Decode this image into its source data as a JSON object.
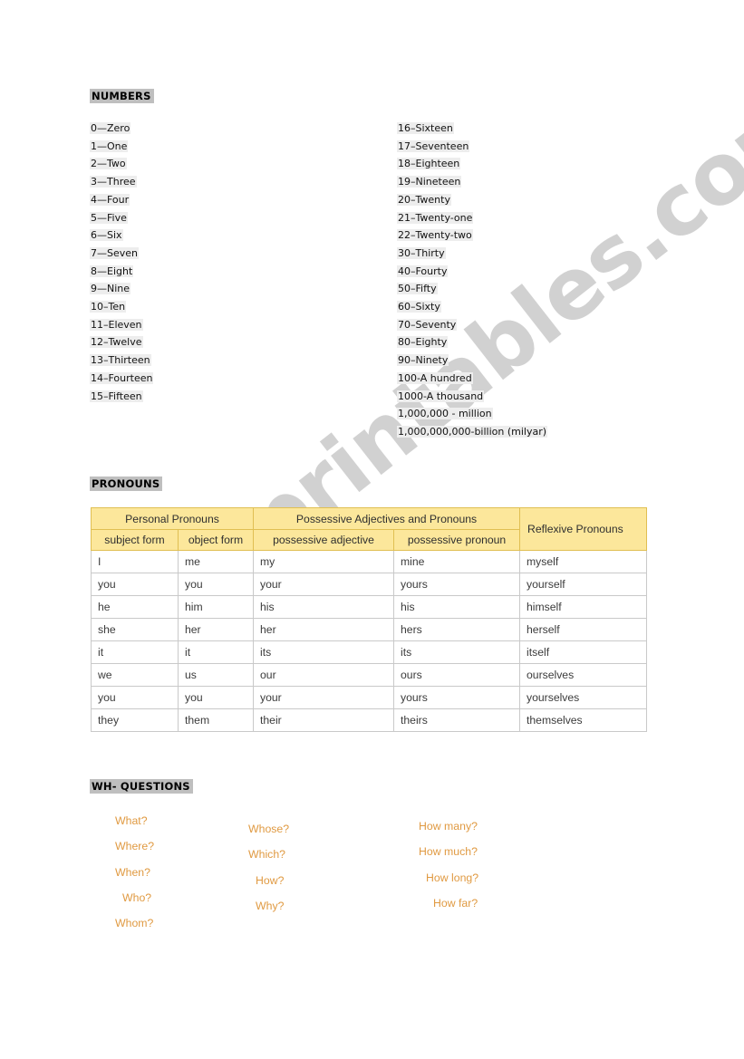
{
  "worksheet": {
    "watermark": "ESLprintables.com"
  },
  "numbers": {
    "heading": "NUMBERS",
    "left_column": [
      "0—Zero",
      "1—One",
      "2—Two",
      "3—Three",
      "4—Four",
      "5—Five",
      "6—Six",
      "7—Seven",
      "8—Eight",
      "9—Nine",
      "10–Ten",
      "11–Eleven",
      "12–Twelve",
      "13–Thirteen",
      "14–Fourteen",
      "15–Fifteen"
    ],
    "right_column": [
      "16–Sixteen",
      "17–Seventeen",
      "18–Eighteen",
      "19–Nineteen",
      "20–Twenty",
      "21–Twenty-one",
      "22–Twenty-two",
      "30–Thirty",
      "40–Fourty",
      "50–Fifty",
      "60–Sixty",
      "70–Seventy",
      "80–Eighty",
      "90–Ninety",
      "100-A hundred",
      "1000-A thousand",
      "1,000,000 - million",
      "1,000,000,000-billion (milyar)"
    ]
  },
  "pronouns": {
    "heading": "PRONOUNS",
    "group_headers": {
      "personal": "Personal Pronouns",
      "possessive": "Possessive Adjectives and Pronouns",
      "reflexive": "Reflexive Pronouns"
    },
    "sub_headers": {
      "subject": "subject form",
      "object": "object form",
      "poss_adjective": "possessive adjective",
      "poss_pronoun": "possessive pronoun"
    },
    "rows": [
      {
        "subject": "I",
        "object": "me",
        "poss_adjective": "my",
        "poss_pronoun": "mine",
        "reflexive": "myself"
      },
      {
        "subject": "you",
        "object": "you",
        "poss_adjective": "your",
        "poss_pronoun": "yours",
        "reflexive": "yourself"
      },
      {
        "subject": "he",
        "object": "him",
        "poss_adjective": "his",
        "poss_pronoun": "his",
        "reflexive": "himself"
      },
      {
        "subject": "she",
        "object": "her",
        "poss_adjective": "her",
        "poss_pronoun": "hers",
        "reflexive": "herself"
      },
      {
        "subject": "it",
        "object": "it",
        "poss_adjective": "its",
        "poss_pronoun": "its",
        "reflexive": "itself"
      },
      {
        "subject": "we",
        "object": "us",
        "poss_adjective": "our",
        "poss_pronoun": "ours",
        "reflexive": "ourselves"
      },
      {
        "subject": "you",
        "object": "you",
        "poss_adjective": "your",
        "poss_pronoun": "yours",
        "reflexive": "yourselves"
      },
      {
        "subject": "they",
        "object": "them",
        "poss_adjective": "their",
        "poss_pronoun": "theirs",
        "reflexive": "themselves"
      }
    ],
    "header_color": "#fce79b",
    "header_border_color": "#e0bf52"
  },
  "wh_questions": {
    "heading": "WH- QUESTIONS",
    "text_color": "#e09a42",
    "column_1": [
      "What?",
      "Where?",
      "When?",
      "Who?",
      "Whom?"
    ],
    "column_2": [
      "Whose?",
      "Which?",
      "How?",
      "Why?"
    ],
    "column_3": [
      "How many?",
      "How much?",
      "How long?",
      "How far?"
    ]
  }
}
